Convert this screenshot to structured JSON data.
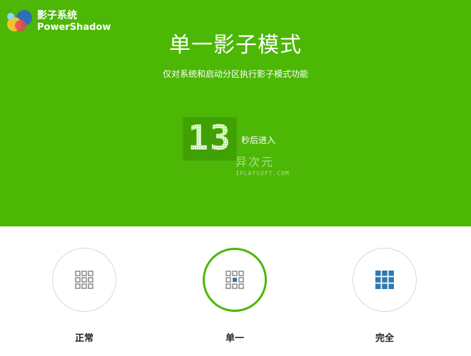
{
  "brand": {
    "name_cn": "影子系统",
    "name_en": "PowerShadow"
  },
  "title": "单一影子模式",
  "subtitle": "仅对系统和启动分区执行影子模式功能",
  "countdown": {
    "value": "13",
    "suffix": "秒后进入"
  },
  "watermark": {
    "big": "异次元",
    "small": "IPLAYSOFT.COM"
  },
  "modes": [
    {
      "label": "正常",
      "icon": "grid-outline-icon"
    },
    {
      "label": "单一",
      "icon": "grid-center-filled-icon",
      "selected": true
    },
    {
      "label": "完全",
      "icon": "grid-filled-icon"
    }
  ],
  "colors": {
    "accent": "#4cb705",
    "icon_fill": "#2f79b3",
    "icon_outline": "#8a8a8a"
  }
}
